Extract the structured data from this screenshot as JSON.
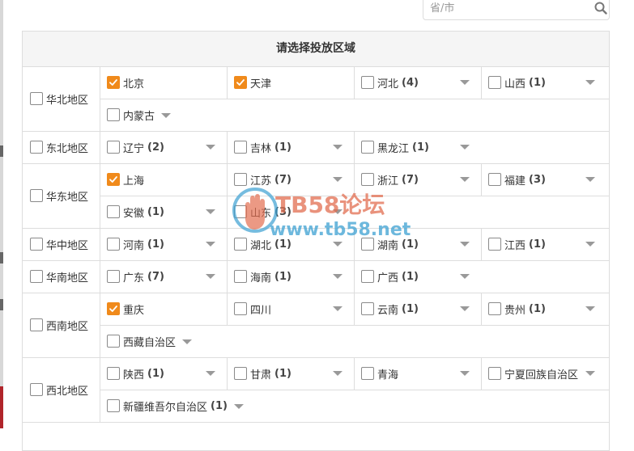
{
  "search": {
    "placeholder": "省/市"
  },
  "table": {
    "title": "请选择投放区域"
  },
  "regions": [
    {
      "label": "华北地区",
      "checked": false,
      "provinces": [
        {
          "name": "北京",
          "count": "",
          "checked": true,
          "dropdown": false
        },
        {
          "name": "天津",
          "count": "",
          "checked": true,
          "dropdown": false
        },
        {
          "name": "河北",
          "count": "(4)",
          "checked": false,
          "dropdown": true
        },
        {
          "name": "山西",
          "count": "(1)",
          "checked": false,
          "dropdown": true
        },
        {
          "name": "内蒙古",
          "count": "",
          "checked": false,
          "dropdown": true
        }
      ]
    },
    {
      "label": "东北地区",
      "checked": false,
      "provinces": [
        {
          "name": "辽宁",
          "count": "(2)",
          "checked": false,
          "dropdown": true
        },
        {
          "name": "吉林",
          "count": "(1)",
          "checked": false,
          "dropdown": true
        },
        {
          "name": "黑龙江",
          "count": "(1)",
          "checked": false,
          "dropdown": true
        }
      ]
    },
    {
      "label": "华东地区",
      "checked": false,
      "provinces": [
        {
          "name": "上海",
          "count": "",
          "checked": true,
          "dropdown": false
        },
        {
          "name": "江苏",
          "count": "(7)",
          "checked": false,
          "dropdown": true
        },
        {
          "name": "浙江",
          "count": "(7)",
          "checked": false,
          "dropdown": true
        },
        {
          "name": "福建",
          "count": "(3)",
          "checked": false,
          "dropdown": true
        },
        {
          "name": "安徽",
          "count": "(1)",
          "checked": false,
          "dropdown": true
        },
        {
          "name": "山东",
          "count": "(3)",
          "checked": false,
          "dropdown": true
        }
      ]
    },
    {
      "label": "华中地区",
      "checked": false,
      "provinces": [
        {
          "name": "河南",
          "count": "(1)",
          "checked": false,
          "dropdown": true
        },
        {
          "name": "湖北",
          "count": "(1)",
          "checked": false,
          "dropdown": true
        },
        {
          "name": "湖南",
          "count": "(1)",
          "checked": false,
          "dropdown": true
        },
        {
          "name": "江西",
          "count": "(1)",
          "checked": false,
          "dropdown": true
        }
      ]
    },
    {
      "label": "华南地区",
      "checked": false,
      "provinces": [
        {
          "name": "广东",
          "count": "(7)",
          "checked": false,
          "dropdown": true
        },
        {
          "name": "海南",
          "count": "(1)",
          "checked": false,
          "dropdown": true
        },
        {
          "name": "广西",
          "count": "(1)",
          "checked": false,
          "dropdown": true
        }
      ]
    },
    {
      "label": "西南地区",
      "checked": false,
      "provinces": [
        {
          "name": "重庆",
          "count": "",
          "checked": true,
          "dropdown": false
        },
        {
          "name": "四川",
          "count": "",
          "checked": false,
          "dropdown": true
        },
        {
          "name": "云南",
          "count": "(1)",
          "checked": false,
          "dropdown": true
        },
        {
          "name": "贵州",
          "count": "(1)",
          "checked": false,
          "dropdown": true
        },
        {
          "name": "西藏自治区",
          "count": "",
          "checked": false,
          "dropdown": true
        }
      ]
    },
    {
      "label": "西北地区",
      "checked": false,
      "provinces": [
        {
          "name": "陕西",
          "count": "(1)",
          "checked": false,
          "dropdown": true
        },
        {
          "name": "甘肃",
          "count": "(1)",
          "checked": false,
          "dropdown": true
        },
        {
          "name": "青海",
          "count": "",
          "checked": false,
          "dropdown": true
        },
        {
          "name": "宁夏回族自治区",
          "count": "",
          "checked": false,
          "dropdown": true
        },
        {
          "name": "新疆维吾尔自治区",
          "count": "(1)",
          "checked": false,
          "dropdown": true
        }
      ]
    }
  ],
  "watermark": {
    "title": "TB58论坛",
    "url": "www.tb58.net"
  },
  "colors": {
    "accent": "#f08a1b",
    "border": "#dddddd",
    "header_bg": "#f5f5f5",
    "arrow": "#999999"
  }
}
